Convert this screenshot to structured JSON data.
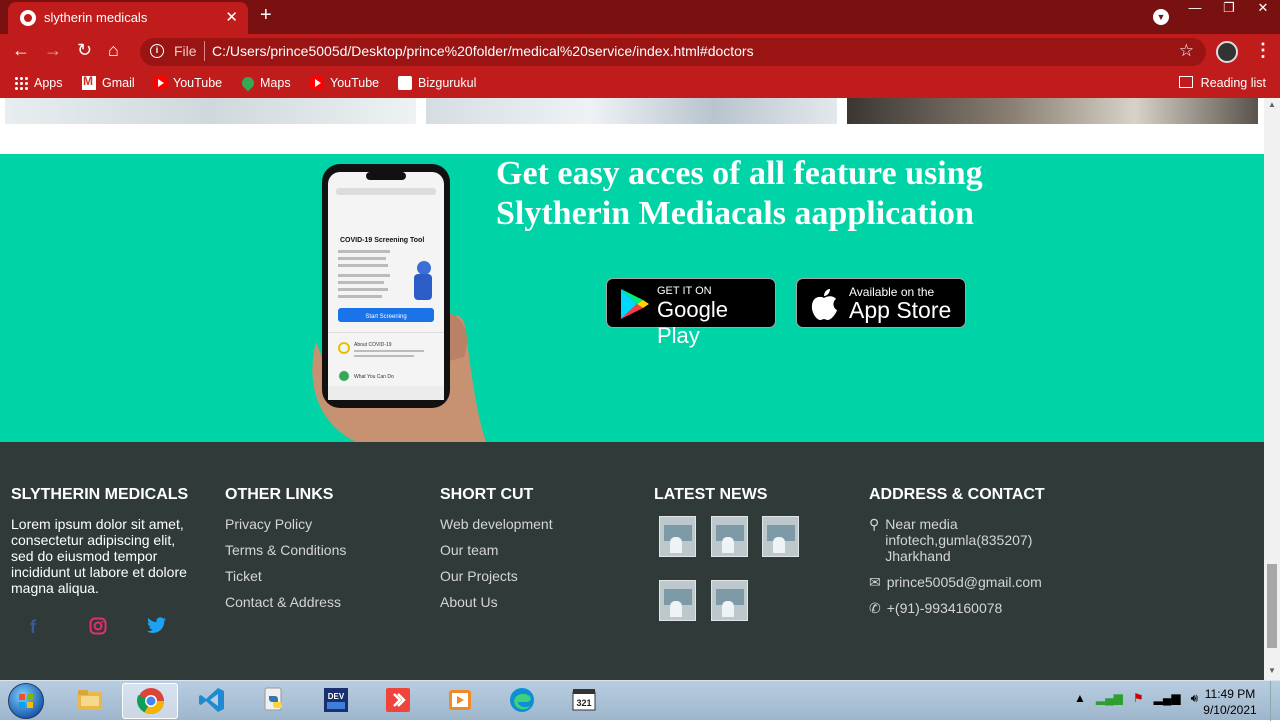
{
  "browser": {
    "tab_title": "slytherin medicals",
    "url_scheme": "File",
    "url": "C:/Users/prince5005d/Desktop/prince%20folder/medical%20service/index.html#doctors",
    "accent_color": "#c01c1c"
  },
  "bookmarks": {
    "items": [
      "Apps",
      "Gmail",
      "YouTube",
      "Maps",
      "YouTube",
      "Bizgurukul"
    ],
    "reading_list": "Reading list"
  },
  "promo": {
    "title": "Get easy acces of all feature using Slytherin Mediacals aapplication",
    "google_play_sub": "GET IT ON",
    "google_play_main": "Google Play",
    "app_store_sub": "Available on the",
    "app_store_main": "App Store",
    "phone_screen": {
      "heading": "COVID-19 Screening Tool",
      "button": "Start Screening",
      "item1": "About COVID-19",
      "item2": "What You Can Do"
    },
    "bg_color": "#00d4a6"
  },
  "footer": {
    "col1": {
      "title": "SLYTHERIN MEDICALS",
      "text": "Lorem ipsum dolor sit amet, consectetur adipiscing elit, sed do eiusmod tempor incididunt ut labore et dolore magna aliqua."
    },
    "col2": {
      "title": "OTHER LINKS",
      "links": [
        "Privacy Policy",
        "Terms & Conditions",
        "Ticket",
        "Contact & Address"
      ]
    },
    "col3": {
      "title": "SHORT CUT",
      "links": [
        "Web development",
        "Our team",
        "Our Projects",
        "About Us"
      ]
    },
    "col4": {
      "title": "LATEST NEWS"
    },
    "col5": {
      "title": "ADDRESS & CONTACT",
      "address": "Near media infotech,gumla(835207) Jharkhand",
      "email": "prince5005d@gmail.com",
      "phone": "+(91)-9934160078"
    },
    "bg_color": "#2f3a39"
  },
  "taskbar": {
    "time": "11:49 PM",
    "date": "9/10/2021"
  }
}
